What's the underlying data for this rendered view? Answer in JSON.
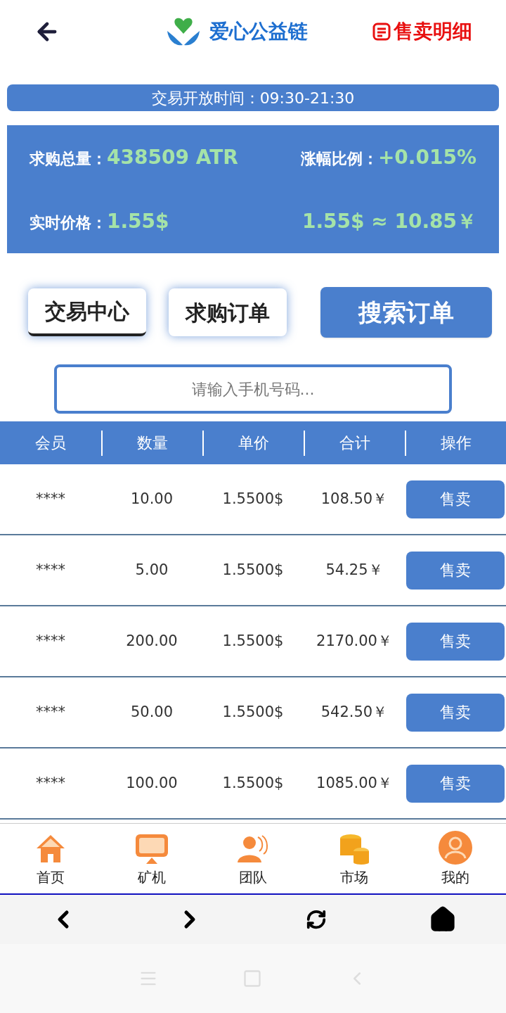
{
  "header": {
    "title": "爱心公益链",
    "action": "售卖明细"
  },
  "trading_hours": "交易开放时间：09:30-21:30",
  "stats": [
    {
      "label": "求购总量：",
      "value": "438509 ATR"
    },
    {
      "label": "涨幅比例：",
      "value": "+0.015%"
    },
    {
      "label": "实时价格：",
      "value": "1.55$"
    },
    {
      "value": "1.55$ ≈ 10.85￥"
    }
  ],
  "tabs": [
    {
      "label": "交易中心",
      "selected": true
    },
    {
      "label": "求购订单",
      "selected": false
    }
  ],
  "search_button": "搜索订单",
  "search": {
    "placeholder": "请输入手机号码..."
  },
  "table": {
    "columns": [
      "会员",
      "数量",
      "单价",
      "合计",
      "操作"
    ],
    "rows": [
      {
        "member": "****",
        "quantity": "10.00",
        "price": "1.5500$",
        "total": "108.50￥",
        "action": "售卖"
      },
      {
        "member": "****",
        "quantity": "5.00",
        "price": "1.5500$",
        "total": "54.25￥",
        "action": "售卖"
      },
      {
        "member": "****",
        "quantity": "200.00",
        "price": "1.5500$",
        "total": "2170.00￥",
        "action": "售卖"
      },
      {
        "member": "****",
        "quantity": "50.00",
        "price": "1.5500$",
        "total": "542.50￥",
        "action": "售卖"
      },
      {
        "member": "****",
        "quantity": "100.00",
        "price": "1.5500$",
        "total": "1085.00￥",
        "action": "售卖"
      }
    ]
  },
  "bottom_nav": [
    {
      "label": "首页",
      "kind": "home"
    },
    {
      "label": "矿机",
      "kind": "monitor"
    },
    {
      "label": "团队",
      "kind": "team"
    },
    {
      "label": "市场",
      "kind": "coins"
    },
    {
      "label": "我的",
      "kind": "user"
    }
  ]
}
